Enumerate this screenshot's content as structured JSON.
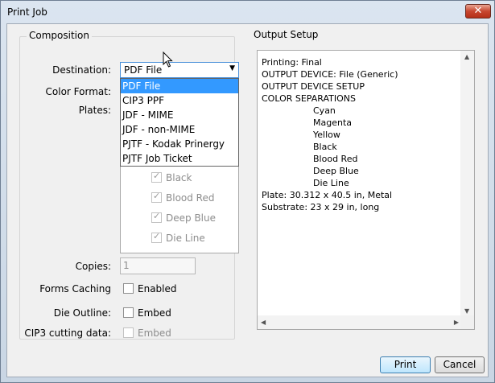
{
  "window": {
    "title": "Print Job",
    "close_label": "✕"
  },
  "composition": {
    "legend": "Composition",
    "destination_label": "Destination:",
    "destination_value": "PDF File",
    "destination_options": [
      "PDF File",
      "CIP3 PPF",
      "JDF - MIME",
      "JDF - non-MIME",
      "PJTF - Kodak Prinergy",
      "PJTF Job Ticket"
    ],
    "color_format_label": "Color Format:",
    "plates_label": "Plates:",
    "plates": [
      "Black",
      "Blood Red",
      "Deep Blue",
      "Die Line"
    ],
    "copies_label": "Copies:",
    "copies_value": "1",
    "forms_caching_label": "Forms Caching",
    "forms_caching_option": "Enabled",
    "die_outline_label": "Die Outline:",
    "die_outline_option": "Embed",
    "cip3_label": "CIP3 cutting data:",
    "cip3_option": "Embed"
  },
  "output": {
    "legend": "Output Setup",
    "lines": [
      {
        "text": "Printing: Final",
        "indent": false
      },
      {
        "text": "OUTPUT DEVICE: File (Generic)",
        "indent": false
      },
      {
        "text": "OUTPUT DEVICE SETUP",
        "indent": false
      },
      {
        "text": "COLOR SEPARATIONS",
        "indent": false
      },
      {
        "text": "Cyan",
        "indent": true
      },
      {
        "text": "Magenta",
        "indent": true
      },
      {
        "text": "Yellow",
        "indent": true
      },
      {
        "text": "Black",
        "indent": true
      },
      {
        "text": "Blood Red",
        "indent": true
      },
      {
        "text": "Deep Blue",
        "indent": true
      },
      {
        "text": "Die Line",
        "indent": true
      },
      {
        "text": "Plate: 30.312 x 40.5 in, Metal",
        "indent": false
      },
      {
        "text": "Substrate: 23 x 29 in, long",
        "indent": false
      }
    ]
  },
  "buttons": {
    "print": "Print",
    "cancel": "Cancel"
  },
  "icons": {
    "dropdown": "chevron-down-icon",
    "scroll_up": "arrow-up-icon",
    "scroll_down": "arrow-down-icon",
    "scroll_left": "arrow-left-icon",
    "scroll_right": "arrow-right-icon",
    "cursor": "mouse-pointer-icon"
  }
}
